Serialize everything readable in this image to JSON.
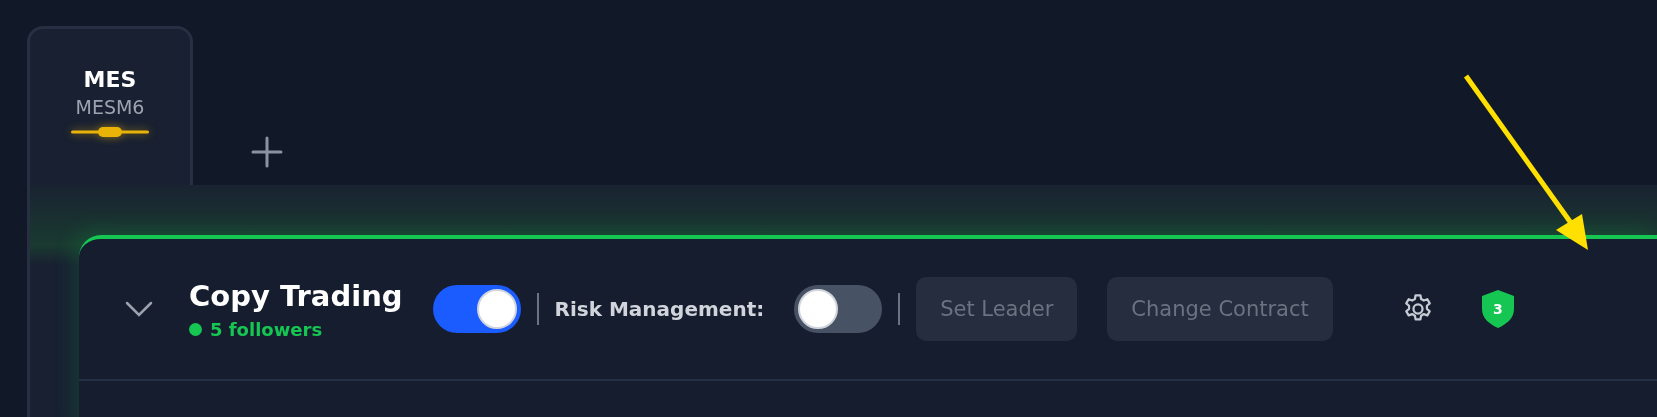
{
  "tabs": [
    {
      "symbol": "MES",
      "contract": "MESM6",
      "selected": true
    }
  ],
  "copy_trading": {
    "expanded": false,
    "title": "Copy Trading",
    "followers": "5 followers",
    "enabled": true,
    "risk_management": {
      "label": "Risk Management:",
      "on": false
    },
    "buttons": [
      {
        "label": "Set Leader",
        "disabled": true
      },
      {
        "label": "Change Contract",
        "disabled": true
      }
    ],
    "shield_badge": "3"
  }
}
